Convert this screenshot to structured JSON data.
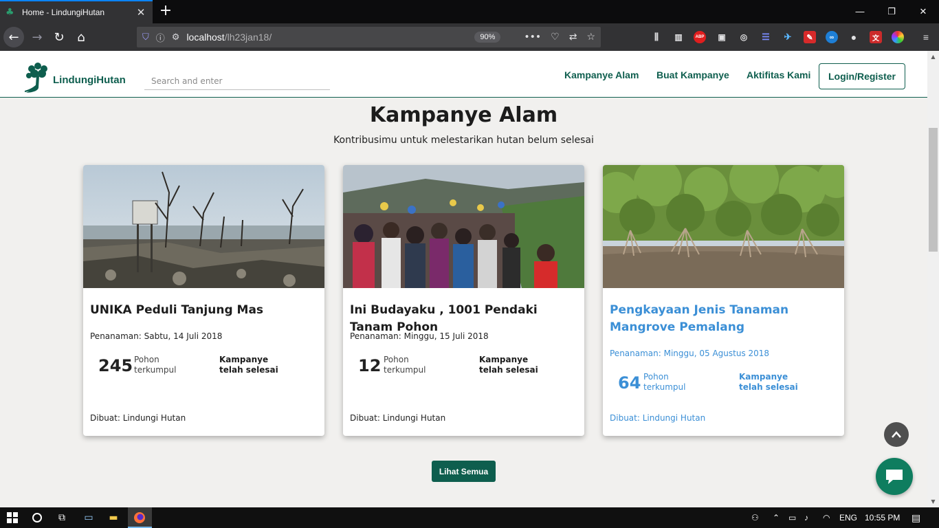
{
  "browser": {
    "tab_title": "Home - LindungiHutan",
    "url_host": "localhost",
    "url_path": "/lh23jan18/",
    "zoom": "90%"
  },
  "header": {
    "brand": "LindungiHutan",
    "search_placeholder": "Search and enter",
    "nav": [
      "Kampanye Alam",
      "Buat Kampanye",
      "Aktifitas Kami"
    ],
    "login_label": "Login/Register"
  },
  "section": {
    "title": "Kampanye Alam",
    "subtitle": "Kontribusimu untuk melestarikan hutan belum selesai"
  },
  "campaigns": [
    {
      "title": "UNIKA Peduli Tanjung Mas",
      "date": "Penanaman: Sabtu, 14 Juli 2018",
      "count": "245",
      "unit_line1": "Pohon",
      "unit_line2": "terkumpul",
      "status_line1": "Kampanye",
      "status_line2": "telah selesai",
      "author": "Dibuat: Lindungi Hutan"
    },
    {
      "title": "Ini Budayaku , 1001 Pendaki Tanam Pohon",
      "date": "Penanaman: Minggu, 15 Juli 2018",
      "count": "12",
      "unit_line1": "Pohon",
      "unit_line2": "terkumpul",
      "status_line1": "Kampanye",
      "status_line2": "telah selesai",
      "author": "Dibuat: Lindungi Hutan"
    },
    {
      "title": "Pengkayaan Jenis Tanaman Mangrove Pemalang",
      "date": "Penanaman: Minggu, 05 Agustus 2018",
      "count": "64",
      "unit_line1": "Pohon",
      "unit_line2": "terkumpul",
      "status_line1": "Kampanye",
      "status_line2": "telah selesai",
      "author": "Dibuat: Lindungi Hutan"
    }
  ],
  "see_all_label": "Lihat Semua",
  "taskbar": {
    "language": "ENG",
    "time": "10:55 PM"
  },
  "colors": {
    "brand_green": "#0e5e4e",
    "link_blue": "#3b8fd6",
    "page_bg": "#f1f0ee"
  }
}
